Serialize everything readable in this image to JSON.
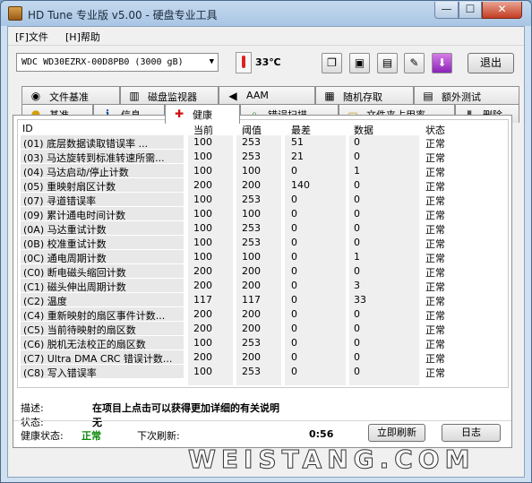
{
  "window": {
    "title": "HD Tune 专业版 v5.00 - 硬盘专业工具",
    "min_label": "—",
    "max_label": "☐",
    "close_label": "✕"
  },
  "menu": {
    "file": "[F]文件",
    "help": "[H]帮助"
  },
  "toolbar": {
    "drive": "WDC WD30EZRX-00D8PB0  (3000 gB)",
    "temperature": "33℃",
    "exit": "退出"
  },
  "tabs_row1": [
    {
      "label": "文件基准",
      "icon": "file-benchmark-icon",
      "glyph": "◉"
    },
    {
      "label": "磁盘监视器",
      "icon": "disk-monitor-icon",
      "glyph": "▥"
    },
    {
      "label": "AAM",
      "icon": "speaker-icon",
      "glyph": "◀"
    },
    {
      "label": "随机存取",
      "icon": "random-access-icon",
      "glyph": "▦"
    },
    {
      "label": "额外测试",
      "icon": "extra-tests-icon",
      "glyph": "▤"
    }
  ],
  "tabs_row2": [
    {
      "label": "基准",
      "icon": "benchmark-icon",
      "glyph": "●"
    },
    {
      "label": "信息",
      "icon": "info-icon",
      "glyph": "ℹ"
    },
    {
      "label": "健康",
      "icon": "health-cross-icon",
      "glyph": "✚"
    },
    {
      "label": "错误扫描",
      "icon": "magnifier-icon",
      "glyph": "⌕"
    },
    {
      "label": "文件夹占用率",
      "icon": "folder-icon",
      "glyph": "▭"
    },
    {
      "label": "删除",
      "icon": "trash-icon",
      "glyph": "▮"
    }
  ],
  "table": {
    "headers": {
      "id": "ID",
      "current": "当前",
      "threshold": "阈值",
      "worst": "最差",
      "data": "数据",
      "status": "状态"
    },
    "rows": [
      {
        "id": "(01) 底层数据读取错误率 ...",
        "current": "100",
        "threshold": "253",
        "worst": "51",
        "data": "0",
        "status": "正常"
      },
      {
        "id": "(03) 马达旋转到标准转速所需...",
        "current": "100",
        "threshold": "253",
        "worst": "21",
        "data": "0",
        "status": "正常"
      },
      {
        "id": "(04) 马达启动/停止计数",
        "current": "100",
        "threshold": "100",
        "worst": "0",
        "data": "1",
        "status": "正常"
      },
      {
        "id": "(05) 重映射扇区计数",
        "current": "200",
        "threshold": "200",
        "worst": "140",
        "data": "0",
        "status": "正常"
      },
      {
        "id": "(07) 寻道错误率",
        "current": "100",
        "threshold": "253",
        "worst": "0",
        "data": "0",
        "status": "正常"
      },
      {
        "id": "(09) 累计通电时间计数",
        "current": "100",
        "threshold": "100",
        "worst": "0",
        "data": "0",
        "status": "正常"
      },
      {
        "id": "(0A) 马达重试计数",
        "current": "100",
        "threshold": "253",
        "worst": "0",
        "data": "0",
        "status": "正常"
      },
      {
        "id": "(0B) 校准重试计数",
        "current": "100",
        "threshold": "253",
        "worst": "0",
        "data": "0",
        "status": "正常"
      },
      {
        "id": "(0C) 通电周期计数",
        "current": "100",
        "threshold": "100",
        "worst": "0",
        "data": "1",
        "status": "正常"
      },
      {
        "id": "(C0) 断电磁头缩回计数",
        "current": "200",
        "threshold": "200",
        "worst": "0",
        "data": "0",
        "status": "正常"
      },
      {
        "id": "(C1) 磁头伸出周期计数",
        "current": "200",
        "threshold": "200",
        "worst": "0",
        "data": "3",
        "status": "正常"
      },
      {
        "id": "(C2) 温度",
        "current": "117",
        "threshold": "117",
        "worst": "0",
        "data": "33",
        "status": "正常"
      },
      {
        "id": "(C4) 重新映射的扇区事件计数...",
        "current": "200",
        "threshold": "200",
        "worst": "0",
        "data": "0",
        "status": "正常"
      },
      {
        "id": "(C5) 当前待映射的扇区数",
        "current": "200",
        "threshold": "200",
        "worst": "0",
        "data": "0",
        "status": "正常"
      },
      {
        "id": "(C6) 脱机无法校正的扇区数",
        "current": "100",
        "threshold": "253",
        "worst": "0",
        "data": "0",
        "status": "正常"
      },
      {
        "id": "(C7) Ultra DMA CRC 错误计数...",
        "current": "200",
        "threshold": "200",
        "worst": "0",
        "data": "0",
        "status": "正常"
      },
      {
        "id": "(C8) 写入错误率",
        "current": "100",
        "threshold": "253",
        "worst": "0",
        "data": "0",
        "status": "正常"
      }
    ]
  },
  "details": {
    "desc_label": "描述:",
    "desc_value": "在项目上点击可以获得更加详细的有关说明",
    "status_label": "状态:",
    "status_value": "无"
  },
  "footer": {
    "health_label": "健康状态:",
    "health_value": "正常",
    "next_refresh_label": "下次刷新:",
    "next_refresh_value": "0:56",
    "refresh_button": "立即刷新",
    "log_button": "日志"
  },
  "watermark": "WEISTANG.COM"
}
